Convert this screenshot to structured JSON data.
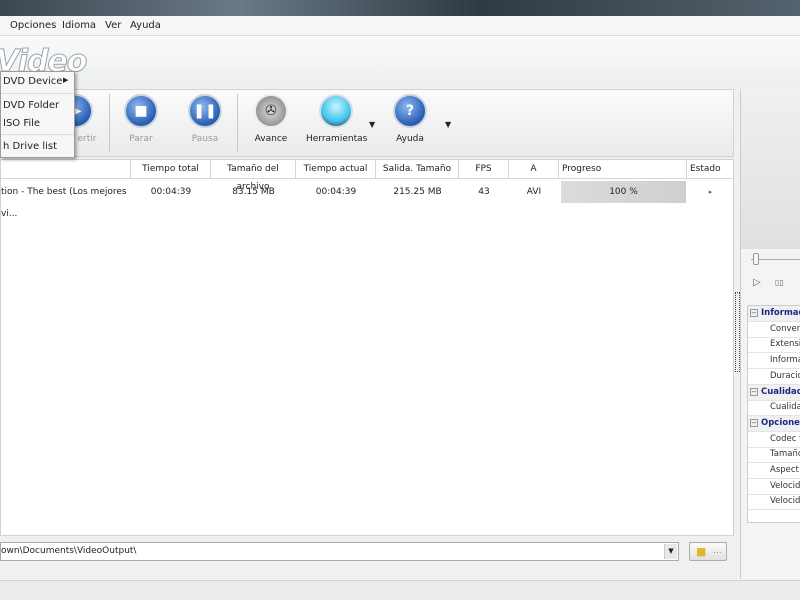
{
  "menu": [
    "Opciones",
    "Idioma",
    "Ver",
    "Ayuda"
  ],
  "logo": "Video",
  "dropdown": {
    "items": [
      "DVD Device",
      "DVD Folder",
      "ISO File",
      "h Drive list"
    ]
  },
  "toolbar": {
    "convert": "ertir",
    "stop": "Parar",
    "pause": "Pausa",
    "preview": "Avance",
    "tools": "Herramientas",
    "help": "Ayuda"
  },
  "table": {
    "headers": [
      "",
      "Tiempo total",
      "Tamaño del archivo",
      "Tiempo actual",
      "Salida. Tamaño",
      "FPS",
      "A",
      "Progreso",
      "Estado"
    ],
    "rows": [
      {
        "name": "tion - The best (Los mejores vi...",
        "total": "00:04:39",
        "size": "83.15 MB",
        "current": "00:04:39",
        "out_size": "215.25 MB",
        "fps": "43",
        "format": "AVI",
        "progress_label": "100 %",
        "progress": 100
      }
    ]
  },
  "output_path": "own\\Documents\\VideoOutput\\",
  "browse": "...",
  "properties": [
    {
      "type": "cat",
      "label": "Informac"
    },
    {
      "type": "item",
      "label": "Convert"
    },
    {
      "type": "item",
      "label": "Extensio"
    },
    {
      "type": "item",
      "label": "Informa"
    },
    {
      "type": "item",
      "label": "Duracio"
    },
    {
      "type": "cat",
      "label": "Cualidad"
    },
    {
      "type": "item",
      "label": "Cualidad"
    },
    {
      "type": "cat",
      "label": "Opciones"
    },
    {
      "type": "item",
      "label": "Codec v"
    },
    {
      "type": "item",
      "label": "Tamaño"
    },
    {
      "type": "item",
      "label": "Aspect"
    },
    {
      "type": "item",
      "label": "Velocid"
    },
    {
      "type": "item",
      "label": "Velocid"
    }
  ]
}
